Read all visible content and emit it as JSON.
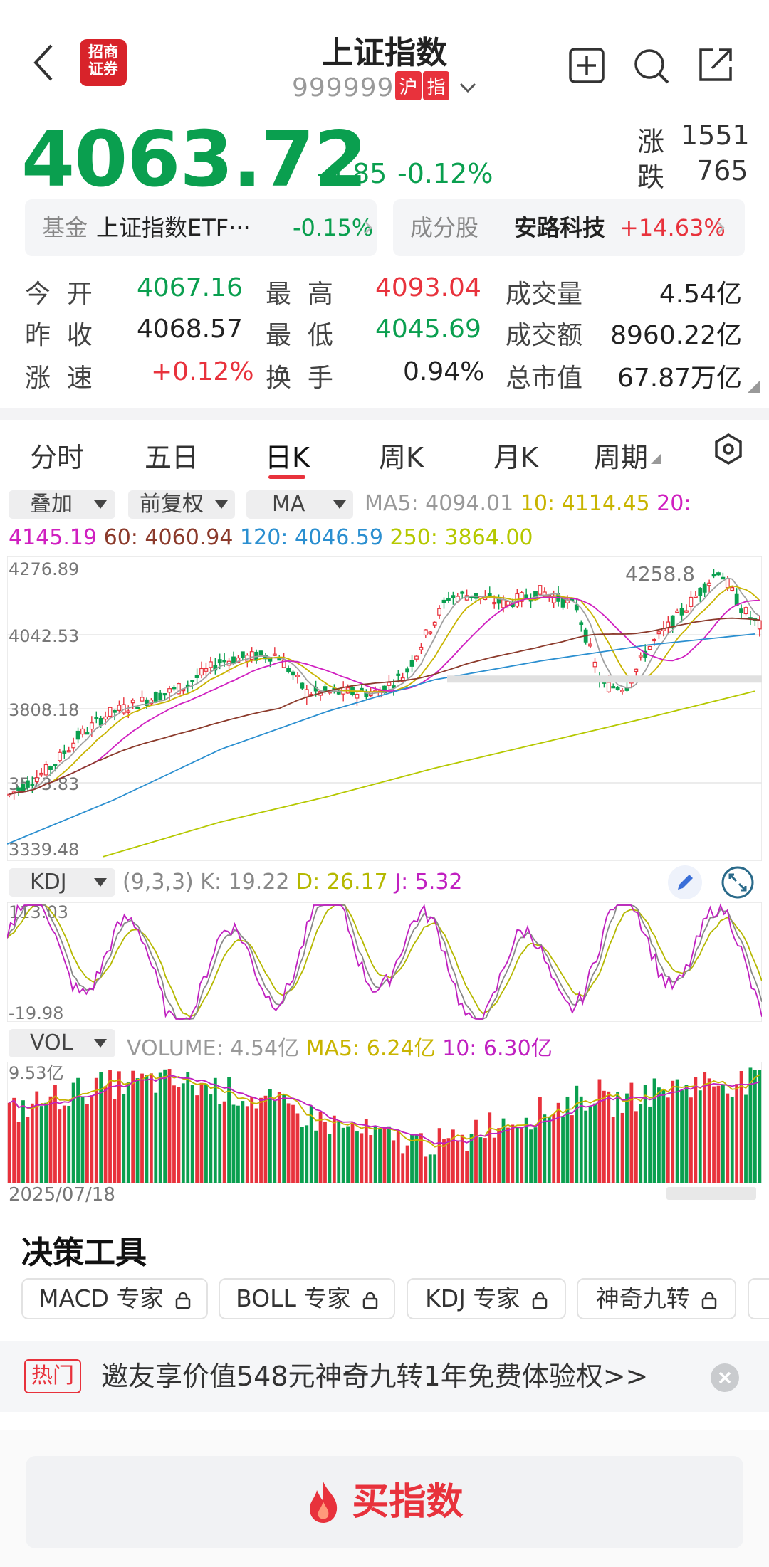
{
  "header": {
    "title": "上证指数",
    "code": "999999",
    "tag1": "沪",
    "tag2": "指",
    "logo_line1": "招商",
    "logo_line2": "证券"
  },
  "quote": {
    "price": "4063.72",
    "change": "-4.85",
    "change_pct": "-0.12%",
    "rise_label": "涨",
    "rise_count": "1551",
    "fall_label": "跌",
    "fall_count": "765"
  },
  "cards": {
    "fund_label": "基金",
    "fund_name": "上证指数ETF···",
    "fund_pct": "-0.15%",
    "comp_label": "成分股",
    "comp_name": "安路科技",
    "comp_pct": "+14.63%"
  },
  "stats": {
    "open_label": "今  开",
    "open": "4067.16",
    "high_label": "最  高",
    "high": "4093.04",
    "volume_label": "成交量",
    "volume": "4.54亿",
    "prev_label": "昨  收",
    "prev": "4068.57",
    "low_label": "最  低",
    "low": "4045.69",
    "amount_label": "成交额",
    "amount": "8960.22亿",
    "speed_label": "涨  速",
    "speed": "+0.12%",
    "turnover_label": "换  手",
    "turnover": "0.94%",
    "mcap_label": "总市值",
    "mcap": "67.87万亿"
  },
  "tabs": [
    {
      "label": "分时"
    },
    {
      "label": "五日"
    },
    {
      "label": "日K"
    },
    {
      "label": "周K"
    },
    {
      "label": "月K"
    },
    {
      "label": "周期"
    }
  ],
  "active_tab": "日K",
  "controls": {
    "overlay": "叠加",
    "adjust": "前复权",
    "indicator": "MA",
    "ma5": "MA5: 4094.01",
    "ma10": "10: 4114.45",
    "ma20_a": "20:",
    "ma20_b": "4145.19",
    "ma60": "60: 4060.94",
    "ma120": "120: 4046.59",
    "ma250": "250: 3864.00"
  },
  "kdj": {
    "selector": "KDJ",
    "params": "(9,3,3)",
    "k": "K: 19.22",
    "d": "D: 26.17",
    "j": "J: 5.32"
  },
  "vol": {
    "selector": "VOL",
    "volume": "VOLUME: 4.54亿",
    "ma5": "MA5: 6.24亿",
    "ma10": "10: 6.30亿",
    "date": "2025/07/18"
  },
  "chart_data": [
    {
      "type": "candlestick",
      "title": "日K",
      "y_ticks": [
        "4276.89",
        "4042.53",
        "3808.18",
        "3573.83",
        "3339.48"
      ],
      "ylim": [
        3339.48,
        4276.89
      ],
      "peak_label": "4258.8",
      "x_start": "2025/07/18",
      "series": [
        {
          "name": "MA5",
          "color": "#a0a0a0"
        },
        {
          "name": "MA10",
          "color": "#c8b400"
        },
        {
          "name": "MA20",
          "color": "#d020c0"
        },
        {
          "name": "MA60",
          "color": "#8b3a2b"
        },
        {
          "name": "MA120",
          "color": "#2b8fd0"
        },
        {
          "name": "MA250",
          "color": "#b5c800"
        }
      ],
      "grid": true
    },
    {
      "type": "line",
      "title": "KDJ",
      "y_ticks": [
        "113.03",
        "-19.98"
      ],
      "ylim": [
        -19.98,
        113.03
      ],
      "series": [
        {
          "name": "K",
          "color": "#888888"
        },
        {
          "name": "D",
          "color": "#b5b800"
        },
        {
          "name": "J",
          "color": "#c020c0"
        }
      ]
    },
    {
      "type": "bar",
      "title": "VOL",
      "y_ticks": [
        "9.53亿"
      ],
      "ylim": [
        0,
        9.53
      ]
    }
  ],
  "tools": {
    "title": "决策工具",
    "chips": [
      "MACD 专家",
      "BOLL 专家",
      "KDJ 专家",
      "神奇九转"
    ]
  },
  "promo": {
    "tag": "热门",
    "text": "邀友享价值548元神奇九转1年免费体验权>>"
  },
  "buy": {
    "label": "买指数"
  },
  "colors": {
    "up": "#e8323c",
    "down": "#0a9f4f",
    "accent": "#e8323c"
  }
}
